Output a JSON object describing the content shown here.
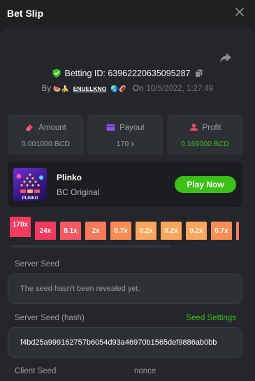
{
  "header": {
    "title": "Bet Slip"
  },
  "bet": {
    "id_label": "Betting ID: 63962220635095287",
    "by": "By",
    "username": "ENUELKNO",
    "emoji_left": "🍉🍌",
    "emoji_right": "🌏🏈",
    "on": "On",
    "date": "10/5/2022, 1:27:49"
  },
  "stats": [
    {
      "label": "Amount",
      "value": "0.001000 BCD",
      "icon": "coins-icon"
    },
    {
      "label": "Payout",
      "value": "170 x",
      "icon": "wallet-icon"
    },
    {
      "label": "Profit",
      "value": "0.169000 BCD",
      "icon": "profit-icon"
    }
  ],
  "game": {
    "name": "Plinko",
    "provider": "BC Original",
    "play_label": "Play Now",
    "thumb_text": "PLINKO"
  },
  "multipliers": [
    "170x",
    "24x",
    "8.1x",
    "2x",
    "0.7x",
    "0.2x",
    "0.2x",
    "0.2x",
    "0.7x"
  ],
  "multiplier_colors": [
    "#f03a5e",
    "#f03a5e",
    "#f35a64",
    "#f77a5a",
    "#f98e55",
    "#fba65a",
    "#fba65a",
    "#fba65a",
    "#f98e55",
    "#f77a5a"
  ],
  "server_seed": {
    "label": "Server Seed",
    "placeholder": "The seed hasn't been revealed yet."
  },
  "server_seed_hash": {
    "label": "Server Seed (hash)",
    "link": "Seed Settings",
    "value": "f4bd25a999162757b6054d93a46970b1565def9886ab0bb"
  },
  "client_seed": {
    "label": "Client Seed"
  },
  "nonce": {
    "label": "nonce"
  },
  "colors": {
    "accent": "#3bc117",
    "panel": "#24262b",
    "card": "#2d3035"
  }
}
